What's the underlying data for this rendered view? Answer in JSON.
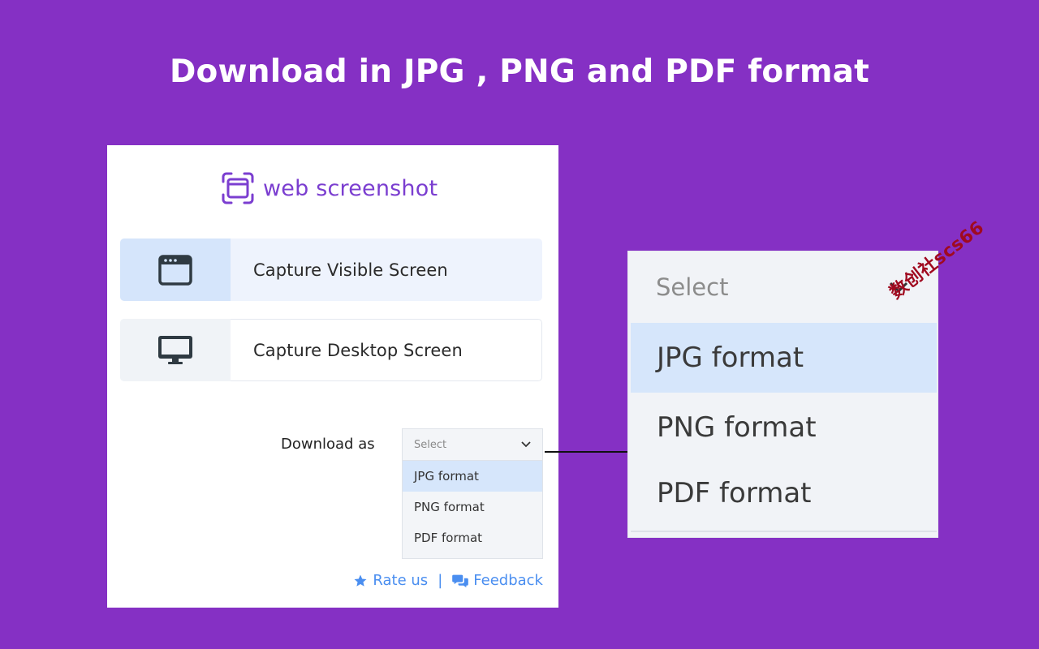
{
  "headline": "Download in JPG , PNG and PDF format",
  "popup": {
    "brand_name": "web screenshot",
    "brand_icon": "frame-capture-icon",
    "buttons": [
      {
        "label": "Capture Visible Screen",
        "icon": "browser-window-icon"
      },
      {
        "label": "Capture Desktop Screen",
        "icon": "monitor-icon"
      }
    ],
    "download_label": "Download as",
    "select": {
      "value": "Select",
      "options": [
        "JPG format",
        "PNG format",
        "PDF format"
      ],
      "highlighted": "JPG format"
    },
    "footer": {
      "rate_label": "Rate us",
      "separator": "|",
      "feedback_label": "Feedback"
    }
  },
  "zoom": {
    "select_value": "Select",
    "options": [
      "JPG format",
      "PNG format",
      "PDF format"
    ]
  },
  "watermark": "数创社scs66",
  "colors": {
    "background": "#8530c4",
    "brand": "#7b3ed0",
    "link": "#4a8ef0",
    "highlight": "#d6e6fb"
  }
}
